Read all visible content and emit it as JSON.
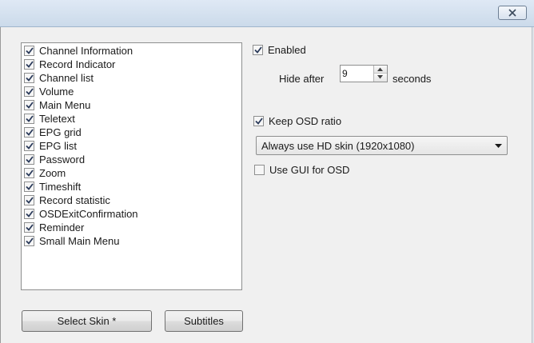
{
  "window": {
    "close_icon": "close-icon"
  },
  "osd_list": {
    "items": [
      {
        "label": "Channel Information",
        "checked": true
      },
      {
        "label": "Record Indicator",
        "checked": true
      },
      {
        "label": "Channel list",
        "checked": true
      },
      {
        "label": "Volume",
        "checked": true
      },
      {
        "label": "Main Menu",
        "checked": true
      },
      {
        "label": "Teletext",
        "checked": true
      },
      {
        "label": "EPG grid",
        "checked": true
      },
      {
        "label": "EPG list",
        "checked": true
      },
      {
        "label": "Password",
        "checked": true
      },
      {
        "label": "Zoom",
        "checked": true
      },
      {
        "label": "Timeshift",
        "checked": true
      },
      {
        "label": "Record statistic",
        "checked": true
      },
      {
        "label": "OSDExitConfirmation",
        "checked": true
      },
      {
        "label": "Reminder",
        "checked": true
      },
      {
        "label": "Small Main Menu",
        "checked": true
      }
    ]
  },
  "settings": {
    "enabled": {
      "label": "Enabled",
      "checked": true
    },
    "hide_after": {
      "label": "Hide after",
      "value": "9",
      "suffix": "seconds"
    },
    "keep_osd_ratio": {
      "label": "Keep OSD ratio",
      "checked": true
    },
    "skin_select": {
      "value": "Always use HD skin (1920x1080)"
    },
    "use_gui_for_osd": {
      "label": "Use GUI for OSD",
      "checked": false
    }
  },
  "buttons": {
    "select_skin": "Select Skin *",
    "subtitles": "Subtitles"
  }
}
